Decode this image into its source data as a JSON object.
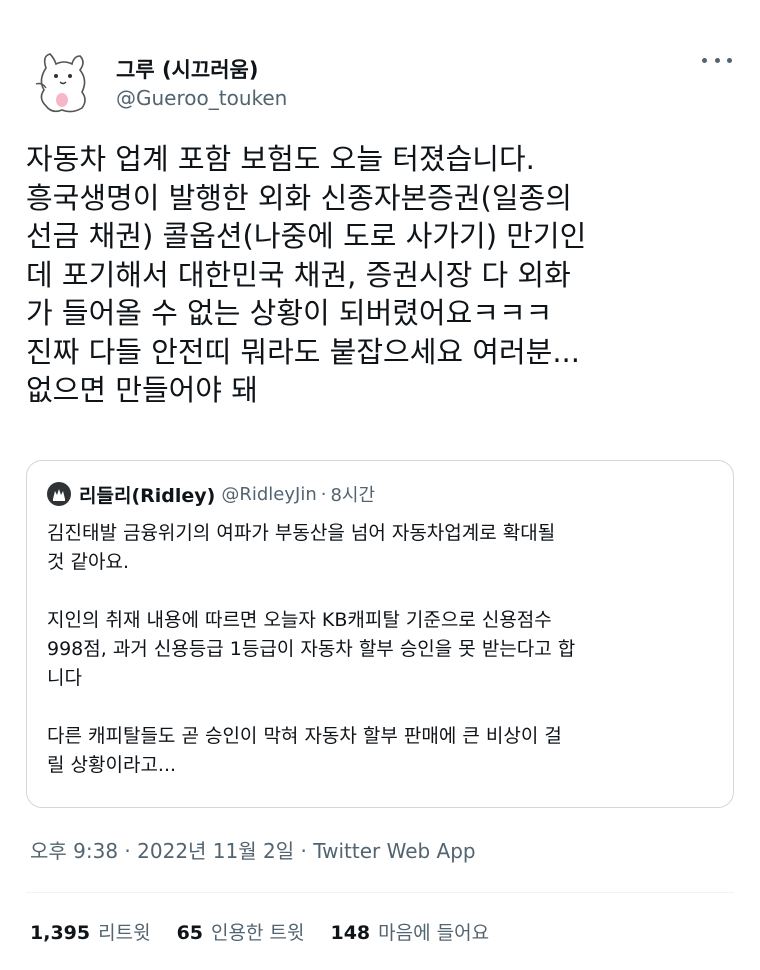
{
  "author": {
    "name": "그루 (시끄러움)",
    "handle": "@Gueroo_touken"
  },
  "tweet_lines": [
    "자동차 업계 포함 보험도 오늘 터졌습니다.",
    "흥국생명이 발행한 외화 신종자본증권(일종의",
    "선금 채권) 콜옵션(나중에 도로 사가기) 만기인",
    "데  포기해서 대한민국 채권, 증권시장 다 외화",
    "가 들어올 수 없는 상황이 되버렸어요ㅋㅋㅋ",
    "진짜 다들 안전띠 뭐라도 붙잡으세요 여러분...",
    "없으면 만들어야 돼"
  ],
  "quote": {
    "name": "리들리(Ridley)",
    "handle": "@RidleyJin",
    "separator": "·",
    "time": "8시간",
    "lines": [
      "김진태발 금융위기의 여파가 부동산을 넘어 자동차업계로 확대될",
      "것 같아요.",
      "",
      "지인의 취재 내용에 따르면 오늘자 KB캐피탈 기준으로 신용점수",
      "998점, 과거 신용등급 1등급이 자동차 할부 승인을 못 받는다고 합",
      "니다",
      "",
      "다른 캐피탈들도 곧 승인이 막혀 자동차 할부 판매에 큰 비상이 걸",
      "릴 상황이라고..."
    ]
  },
  "meta": "오후 9:38 · 2022년 11월 2일 · Twitter Web App",
  "stats": {
    "retweets_count": "1,395",
    "retweets_label": "리트윗",
    "quotes_count": "65",
    "quotes_label": "인용한 트윗",
    "likes_count": "148",
    "likes_label": "마음에 들어요"
  },
  "icons": {
    "avatar": "white-cat-avatar-icon",
    "quote_avatar": "ridley-avatar-icon",
    "more": "more-options-icon"
  }
}
